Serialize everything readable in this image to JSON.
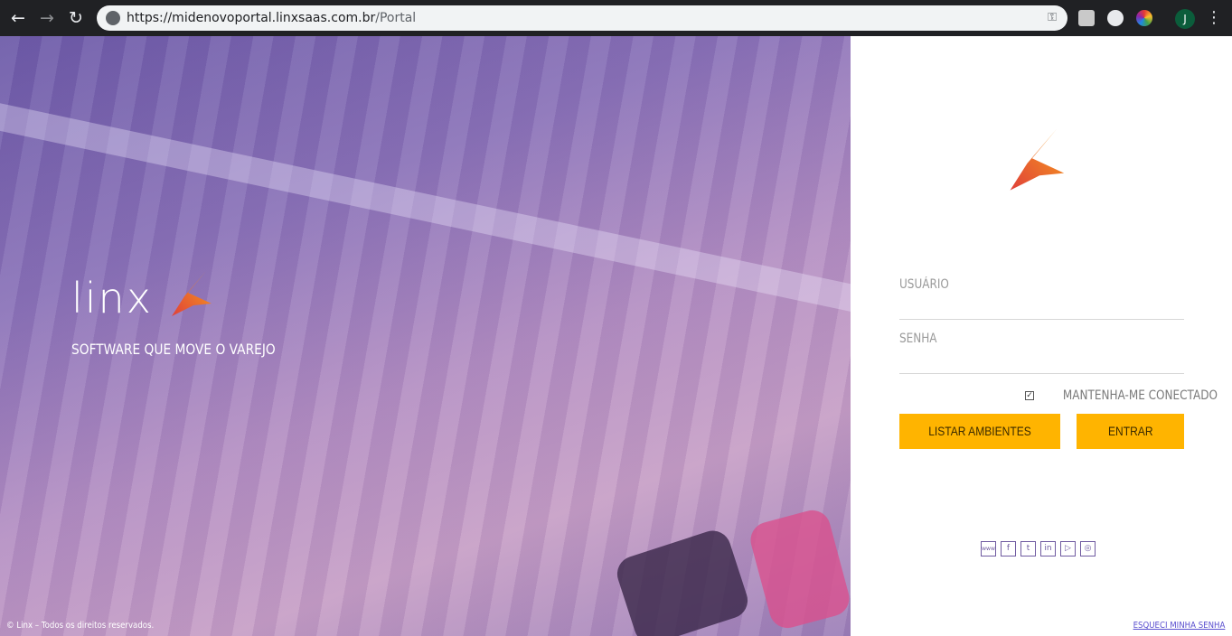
{
  "browser": {
    "url_host": "https://midenovoportal.linxsaas.com.br",
    "url_path": "/Portal",
    "avatar_letter": "J",
    "back_icon": "arrow-left-icon",
    "forward_icon": "arrow-right-icon",
    "reload_icon": "reload-icon",
    "key_icon": "key-icon"
  },
  "hero": {
    "brand_name": "Linx",
    "tagline": "SOFTWARE QUE MOVE O VAREJO",
    "copyright": "© Linx – Todos os direitos reservados."
  },
  "login": {
    "username_label": "USUÁRIO",
    "password_label": "SENHA",
    "remember_label": "MANTENHA-ME CONECTADO",
    "remember_checked": true,
    "list_button": "LISTAR AMBIENTES",
    "enter_button": "ENTRAR",
    "forgot_link": "ESQUECI MINHA SENHA"
  },
  "social": [
    {
      "name": "www-icon",
      "glyph": "www"
    },
    {
      "name": "facebook-icon",
      "glyph": "f"
    },
    {
      "name": "twitter-icon",
      "glyph": "t"
    },
    {
      "name": "linkedin-icon",
      "glyph": "in"
    },
    {
      "name": "youtube-icon",
      "glyph": "▷"
    },
    {
      "name": "instagram-icon",
      "glyph": "◎"
    }
  ],
  "colors": {
    "accent": "#ffb400",
    "logo_orange": "#f7a21b",
    "logo_red": "#e0403a",
    "social_purple": "#6f5aa0"
  }
}
